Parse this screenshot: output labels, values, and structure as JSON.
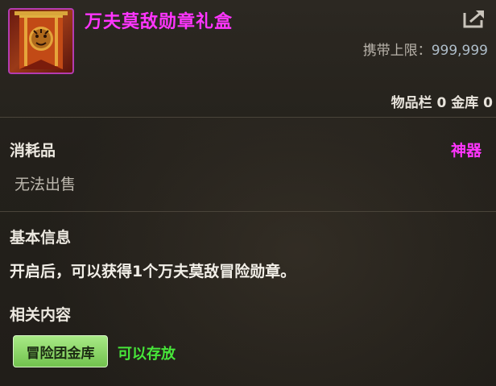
{
  "item": {
    "name": "万夫莫敌勋章礼盒",
    "name_color": "#ff35ff",
    "icon": "tiger-banner-icon"
  },
  "header": {
    "share_icon": "share-icon",
    "limit_label": "携带上限：",
    "limit_value": "999,999",
    "inventory_text": "物品栏 0 金库 0"
  },
  "info": {
    "category": "消耗品",
    "rarity": "神器",
    "rarity_color": "#ff35ff",
    "trade": "无法出售"
  },
  "basic": {
    "title": "基本信息",
    "description": "开启后，可以获得1个万夫莫敌冒险勋章。"
  },
  "related": {
    "title": "相关内容",
    "storage_button": "冒险团金库",
    "storage_note": "可以存放",
    "note_color": "#47e63a"
  }
}
